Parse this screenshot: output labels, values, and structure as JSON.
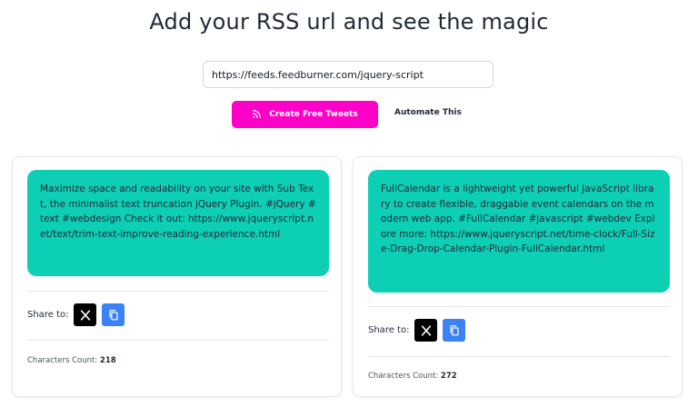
{
  "header": {
    "title": "Add your RSS url and see the magic"
  },
  "form": {
    "url_value": "https://feeds.feedburner.com/jquery-script",
    "create_label": "Create Free Tweets",
    "automate_label": "Automate This"
  },
  "colors": {
    "accent": "#ff00c8",
    "tweet_bg": "#0ccfb5",
    "copy_button": "#3b82f6"
  },
  "icons": {
    "create": "rss-icon",
    "share_x": "x-logo-icon",
    "copy": "copy-icon"
  },
  "cards": [
    {
      "tweet": "Maximize space and readability on your site with Sub Text, the minimalist text truncation jQuery Plugin. #jQuery #text #webdesign Check it out: https://www.jqueryscript.net/text/trim-text-improve-reading-experience.html",
      "share_label": "Share to:",
      "count_label": "Characters Count:",
      "count_value": "218"
    },
    {
      "tweet": "FullCalendar is a lightweight yet powerful JavaScript library to create flexible, draggable event calendars on the modern web app. #FullCalendar #javascript #webdev Explore more: https://www.jqueryscript.net/time-clock/Full-Size-Drag-Drop-Calendar-Plugin-FullCalendar.html",
      "share_label": "Share to:",
      "count_label": "Characters Count:",
      "count_value": "272"
    }
  ]
}
